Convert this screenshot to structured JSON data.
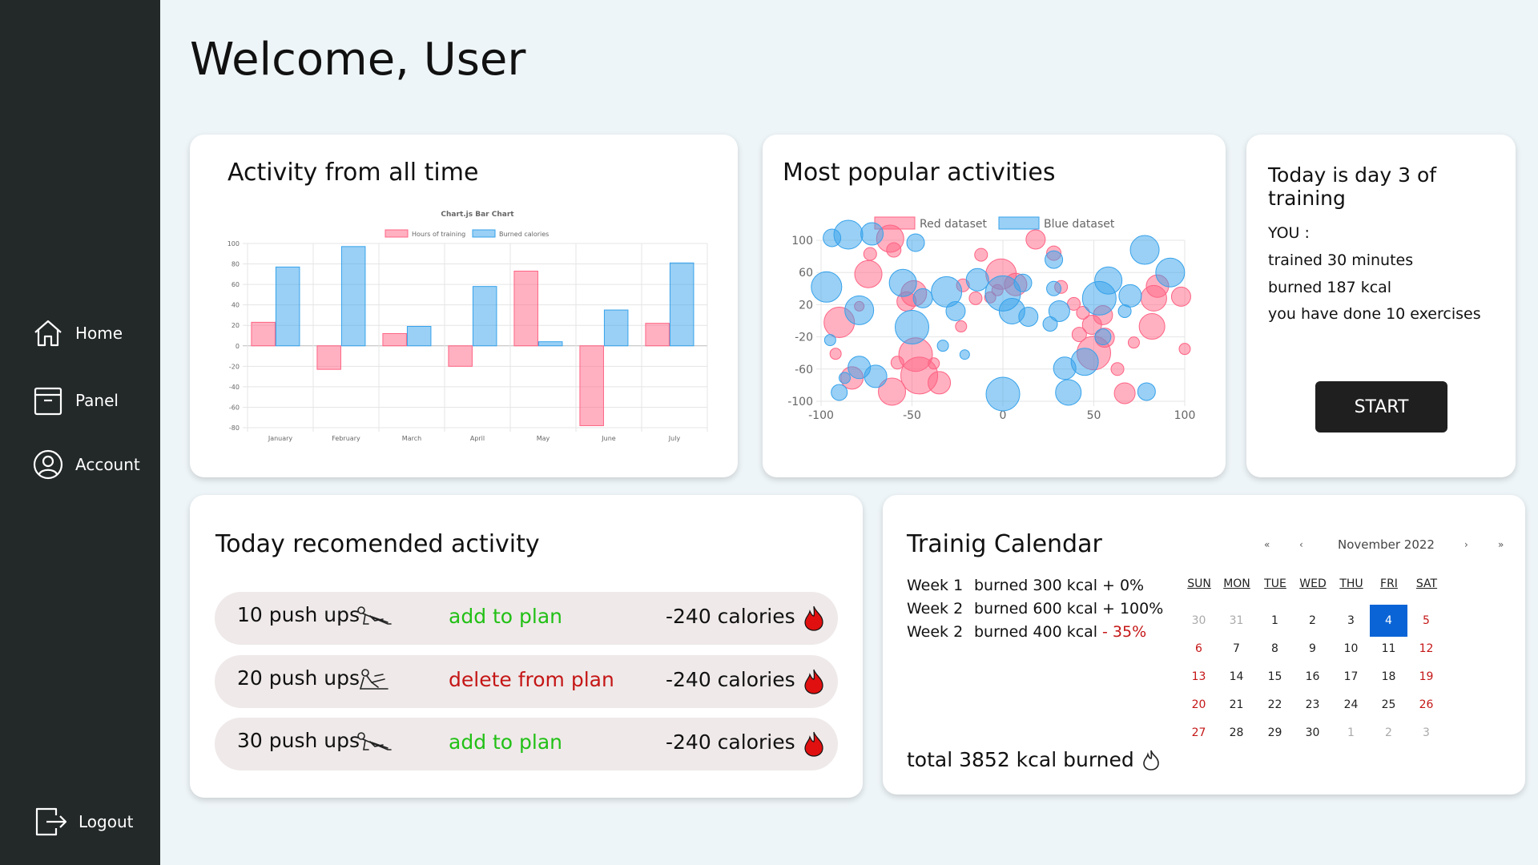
{
  "sidebar": {
    "items": [
      {
        "label": "Home"
      },
      {
        "label": "Panel"
      },
      {
        "label": "Account"
      }
    ],
    "logout": "Logout"
  },
  "header": {
    "title": "Welcome, User"
  },
  "activity_card": {
    "title": "Activity from all time"
  },
  "popular_card": {
    "title": "Most popular activities"
  },
  "today_card": {
    "title": "Today is day 3 of training",
    "you": "YOU :",
    "trained": "trained 30 minutes",
    "burned": "burned 187 kcal",
    "exercises": "you have done 10 exercises",
    "start": "START"
  },
  "recommended": {
    "title": "Today recomended activity",
    "rows": [
      {
        "name": "10 push ups",
        "action": "add to plan",
        "calories": "-240 calories"
      },
      {
        "name": "20 push ups",
        "action": "delete from plan",
        "calories": "-240 calories"
      },
      {
        "name": "30 push ups",
        "action": "add to plan",
        "calories": "-240 calories"
      }
    ]
  },
  "calendar": {
    "title": "Trainig Calendar",
    "weeks": [
      {
        "label": "Week 1",
        "burned": "burned 300 kcal",
        "change": "+ 0%",
        "change_color": "#111111"
      },
      {
        "label": "Week 2",
        "burned": "burned 600 kcal",
        "change": "+ 100%",
        "change_color": "#111111"
      },
      {
        "label": "Week 2",
        "burned": "burned 400 kcal",
        "change": "- 35%",
        "change_color": "#c51616"
      }
    ],
    "total": "total 3852 kcal burned",
    "month": "November 2022",
    "nav": {
      "prev_year": "«",
      "prev": "‹",
      "next": "›",
      "next_year": "»"
    },
    "weekdays": [
      "SUN",
      "MON",
      "TUE",
      "WED",
      "THU",
      "FRI",
      "SAT"
    ],
    "days": [
      [
        "30",
        "31",
        "1",
        "2",
        "3",
        "4",
        "5"
      ],
      [
        "6",
        "7",
        "8",
        "9",
        "10",
        "11",
        "12"
      ],
      [
        "13",
        "14",
        "15",
        "16",
        "17",
        "18",
        "19"
      ],
      [
        "20",
        "21",
        "22",
        "23",
        "24",
        "25",
        "26"
      ],
      [
        "27",
        "28",
        "29",
        "30",
        "1",
        "2",
        "3"
      ]
    ],
    "selected_day": "4"
  },
  "colors": {
    "sidebar": "#232828",
    "background": "#eef5f8",
    "red_series": "#ff6384",
    "blue_series": "#36a2eb",
    "add_green": "#22c016",
    "delete_red": "#c51616",
    "calendar_selected": "#0a64d6"
  },
  "chart_data": [
    {
      "type": "bar",
      "title": "Chart.js Bar Chart",
      "categories": [
        "January",
        "February",
        "March",
        "April",
        "May",
        "June",
        "July"
      ],
      "series": [
        {
          "name": "Hours of training",
          "values": [
            23,
            -23,
            12,
            -20,
            73,
            -78,
            22
          ]
        },
        {
          "name": "Burned calories",
          "values": [
            77,
            97,
            19,
            58,
            4,
            35,
            81
          ]
        }
      ],
      "ylim": [
        -80,
        100
      ],
      "yticks": [
        100,
        80,
        60,
        40,
        20,
        0,
        -20,
        -40,
        -60,
        -80
      ],
      "legend": "top",
      "grid": true
    },
    {
      "type": "scatter",
      "subtype": "bubble",
      "xlim": [
        -100,
        100
      ],
      "ylim": [
        -100,
        100
      ],
      "xticks": [
        -100,
        -50,
        0,
        50,
        100
      ],
      "yticks": [
        100,
        60,
        20,
        -20,
        -60,
        -100
      ],
      "legend": "top",
      "grid": true,
      "series": [
        {
          "name": "Red dataset",
          "points": [
            [
              -62,
              102,
              17
            ],
            [
              -73,
              83,
              8
            ],
            [
              -74,
              58,
              17
            ],
            [
              -90,
              -2,
              19
            ],
            [
              -83,
              -71,
              14
            ],
            [
              -61,
              -88,
              17
            ],
            [
              -46,
              -68,
              23
            ],
            [
              -35,
              -77,
              14
            ],
            [
              -48,
              -42,
              21
            ],
            [
              -49,
              34,
              16
            ],
            [
              -53,
              24,
              12
            ],
            [
              -38,
              -53,
              7
            ],
            [
              -92,
              -41,
              7
            ],
            [
              -58,
              -52,
              8
            ],
            [
              -12,
              82,
              8
            ],
            [
              -1,
              58,
              19
            ],
            [
              -7,
              29,
              7
            ],
            [
              7,
              45,
              14
            ],
            [
              18,
              101,
              12
            ],
            [
              28,
              84,
              9
            ],
            [
              32,
              42,
              8
            ],
            [
              39,
              21,
              8
            ],
            [
              44,
              10,
              8
            ],
            [
              50,
              -40,
              21
            ],
            [
              56,
              -21,
              12
            ],
            [
              63,
              -60,
              8
            ],
            [
              67,
              -90,
              13
            ],
            [
              72,
              -27,
              7
            ],
            [
              82,
              -7,
              16
            ],
            [
              85,
              43,
              14
            ],
            [
              83,
              28,
              16
            ],
            [
              98,
              30,
              12
            ],
            [
              100,
              -35,
              7
            ],
            [
              55,
              7,
              12
            ],
            [
              49,
              -5,
              12
            ],
            [
              -60,
              88,
              9
            ],
            [
              -79,
              18,
              6
            ],
            [
              -22,
              44,
              8
            ],
            [
              -15,
              28,
              8
            ],
            [
              -3,
              38,
              7
            ],
            [
              42,
              -17,
              9
            ],
            [
              -23,
              -7,
              7
            ]
          ]
        },
        {
          "name": "Blue dataset",
          "points": [
            [
              -94,
              103,
              11
            ],
            [
              -85,
              107,
              18
            ],
            [
              -72,
              108,
              14
            ],
            [
              -48,
              97,
              11
            ],
            [
              -97,
              42,
              19
            ],
            [
              -79,
              13,
              18
            ],
            [
              -50,
              -8,
              21
            ],
            [
              -33,
              -31,
              7
            ],
            [
              -95,
              -24,
              7
            ],
            [
              -90,
              -89,
              10
            ],
            [
              -87,
              -71,
              7
            ],
            [
              -79,
              -58,
              14
            ],
            [
              -70,
              -69,
              14
            ],
            [
              -55,
              47,
              17
            ],
            [
              -44,
              28,
              12
            ],
            [
              -31,
              36,
              19
            ],
            [
              -26,
              12,
              12
            ],
            [
              -14,
              51,
              14
            ],
            [
              -21,
              -42,
              6
            ],
            [
              0,
              34,
              22
            ],
            [
              11,
              47,
              11
            ],
            [
              5,
              12,
              16
            ],
            [
              14,
              5,
              12
            ],
            [
              0,
              -91,
              21
            ],
            [
              28,
              76,
              11
            ],
            [
              28,
              40,
              9
            ],
            [
              31,
              12,
              13
            ],
            [
              26,
              -4,
              9
            ],
            [
              34,
              -59,
              14
            ],
            [
              36,
              -89,
              16
            ],
            [
              45,
              -51,
              17
            ],
            [
              53,
              28,
              21
            ],
            [
              55,
              -20,
              10
            ],
            [
              78,
              88,
              18
            ],
            [
              92,
              60,
              18
            ],
            [
              79,
              -88,
              11
            ],
            [
              67,
              12,
              8
            ],
            [
              58,
              50,
              17
            ],
            [
              70,
              31,
              14
            ]
          ]
        }
      ]
    }
  ]
}
